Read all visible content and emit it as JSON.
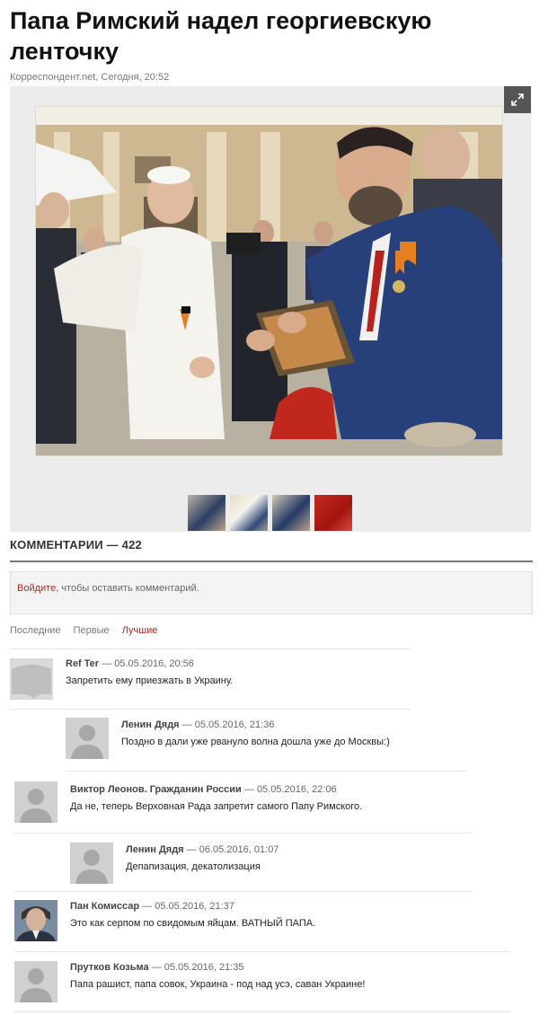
{
  "article": {
    "title": "Папа Римский надел георгиевскую ленточку",
    "meta": "Корреспондент.net, Сегодня, 20:52"
  },
  "gallery": {
    "expand_icon": "expand-arrows-icon",
    "thumbnail_count": 4
  },
  "comments": {
    "header": "КОММЕНТАРИИ — 422",
    "login_link": "Войдите",
    "login_text": ", чтобы оставить комментарий.",
    "tabs": [
      {
        "label": "Последние"
      },
      {
        "label": "Первые"
      },
      {
        "label": "Лучшие"
      }
    ],
    "active_tab": "Лучшие",
    "items": [
      {
        "author": "Ref Ter",
        "date": "05.05.2016, 20:56",
        "text": "Запретить ему приезжать в Украину.",
        "avatar": "speech-bubble-avatar-icon"
      },
      {
        "author": "Ленин Дядя",
        "date": "05.05.2016, 21:36",
        "text": "Поздно в дали уже рвануло волна дошла уже до Москвы:)",
        "avatar": "default-user-avatar-icon"
      },
      {
        "author": "Виктор Леонов. Гражданин России",
        "date": "05.05.2016, 22:06",
        "text": "Да не, теперь Верховная Рада запретит самого Папу Римского.",
        "avatar": "default-user-avatar-icon"
      },
      {
        "author": "Ленин Дядя",
        "date": "06.05.2016, 01:07",
        "text": "Депапизация, декатолизация",
        "avatar": "default-user-avatar-icon"
      },
      {
        "author": "Пан Комиссар",
        "date": "05.05.2016, 21:37",
        "text": "Это как серпом по свидомым яйцам. ВАТНЫЙ ПАПА.",
        "avatar": "user-photo-avatar"
      },
      {
        "author": "Прутков Козьма",
        "date": "05.05.2016, 21:35",
        "text": "Папа рашист, папа совок, Украина - под над усэ, саван Украине!",
        "avatar": "default-user-avatar-icon"
      }
    ]
  },
  "colors": {
    "accent": "#b3261e",
    "text": "#222222",
    "muted": "#777777",
    "gallery_bg": "#ececec"
  }
}
